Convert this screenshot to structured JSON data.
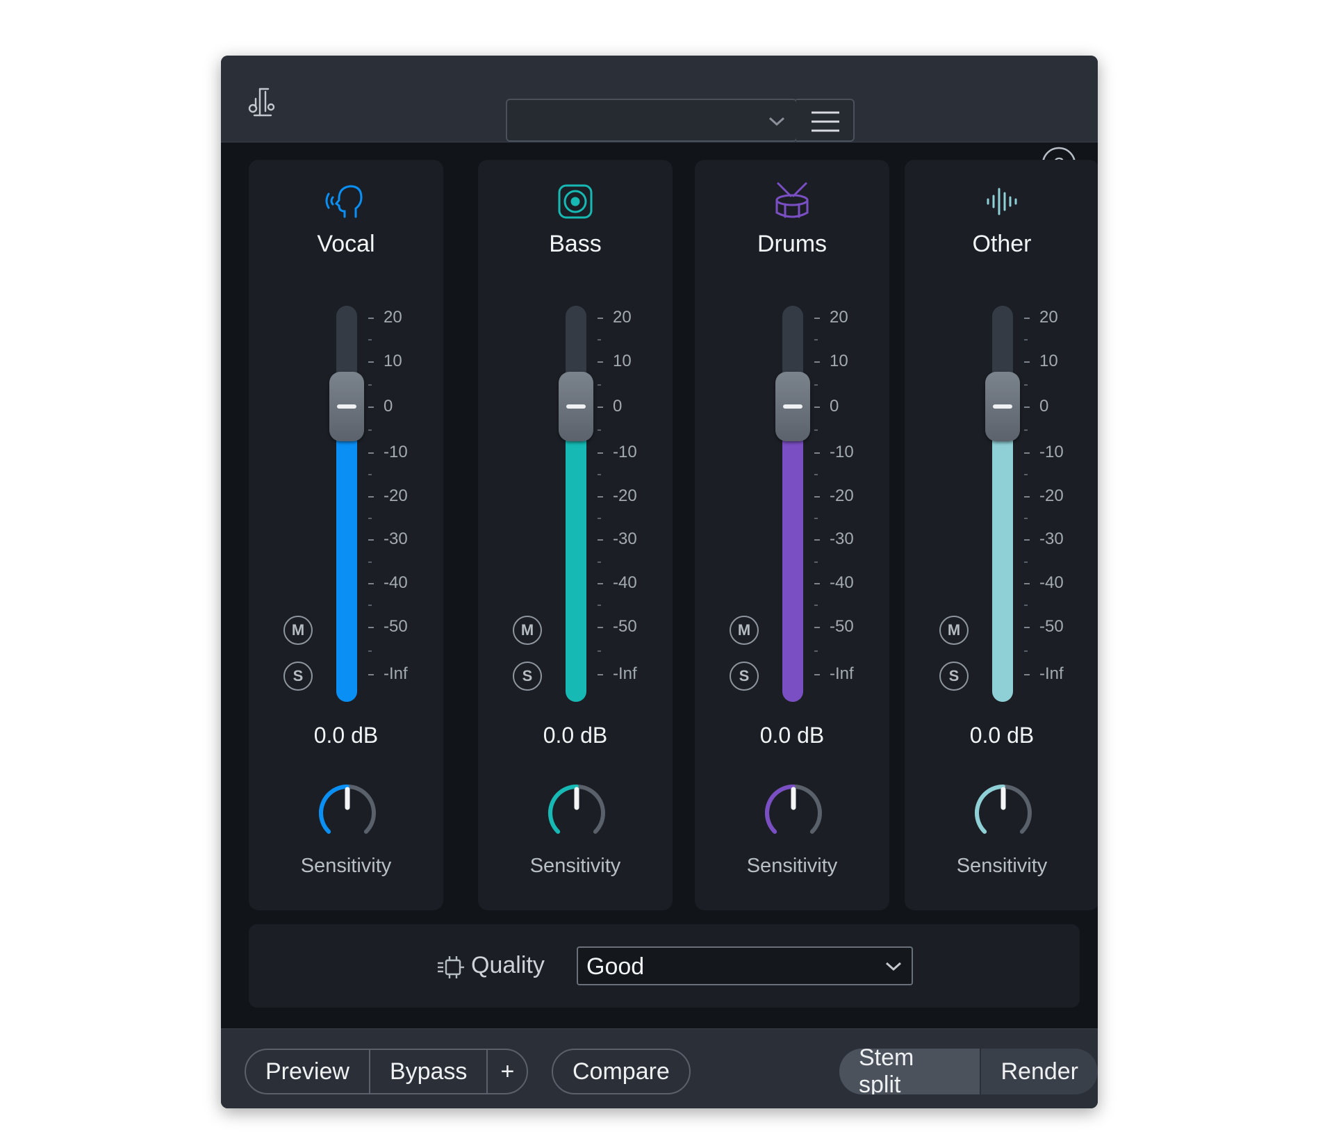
{
  "header": {
    "preset_value": "",
    "logo_icon": "tuning-fork-logo-icon",
    "menu_icon": "hamburger-menu-icon",
    "help_icon": "question-mark-icon"
  },
  "scale_labels": [
    "20",
    "10",
    "0",
    "-10",
    "-20",
    "-30",
    "-40",
    "-50",
    "-Inf"
  ],
  "modules": [
    {
      "key": "vocal",
      "title": "Vocal",
      "icon": "head-speaking-icon",
      "color": "#0a8ff5",
      "gain_db": 0.0,
      "gain_text": "0.0 dB",
      "mute_label": "M",
      "solo_label": "S",
      "sensitivity_label": "Sensitivity",
      "sensitivity": 0.5
    },
    {
      "key": "bass",
      "title": "Bass",
      "icon": "speaker-icon",
      "color": "#16b9b3",
      "gain_db": 0.0,
      "gain_text": "0.0 dB",
      "mute_label": "M",
      "solo_label": "S",
      "sensitivity_label": "Sensitivity",
      "sensitivity": 0.5
    },
    {
      "key": "drums",
      "title": "Drums",
      "icon": "drum-icon",
      "color": "#7b4fc4",
      "gain_db": 0.0,
      "gain_text": "0.0 dB",
      "mute_label": "M",
      "solo_label": "S",
      "sensitivity_label": "Sensitivity",
      "sensitivity": 0.5
    },
    {
      "key": "other",
      "title": "Other",
      "icon": "waveform-icon",
      "color": "#8fd0d6",
      "gain_db": 0.0,
      "gain_text": "0.0 dB",
      "mute_label": "M",
      "solo_label": "S",
      "sensitivity_label": "Sensitivity",
      "sensitivity": 0.5
    }
  ],
  "quality": {
    "label": "Quality",
    "value": "Good",
    "icon": "processor-chip-icon"
  },
  "footer": {
    "preview": "Preview",
    "bypass": "Bypass",
    "plus": "+",
    "compare": "Compare",
    "stem_split": "Stem split",
    "render": "Render"
  }
}
